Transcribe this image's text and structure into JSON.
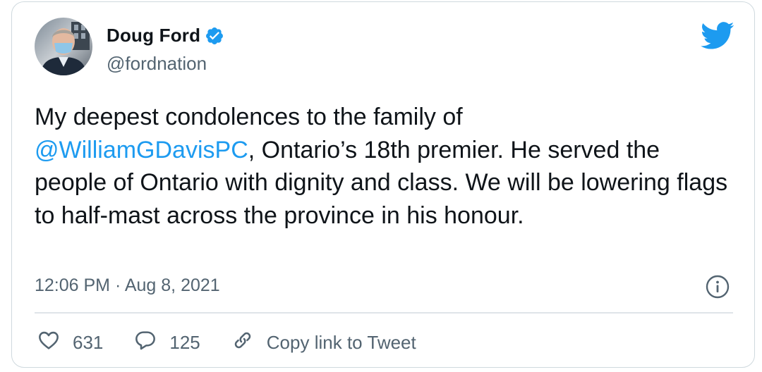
{
  "author": {
    "display_name": "Doug Ford",
    "handle": "@fordnation",
    "verified": true
  },
  "tweet": {
    "line1": "My deepest condolences to the family of",
    "mention": "@WilliamGDavisPC",
    "rest": ", Ontario’s 18th premier. He served the people of Ontario with dignity and class. We will be lowering flags to half-mast across the province in his honour.",
    "timestamp": "12:06 PM · Aug 8, 2021"
  },
  "actions": {
    "likes": "631",
    "replies": "125",
    "copy_link_label": "Copy link to Tweet"
  },
  "colors": {
    "accent": "#1d9bf0",
    "text": "#0f1419",
    "muted": "#536471",
    "border": "#cfd9de"
  },
  "icons": {
    "verified": "verified-badge-icon",
    "brand": "twitter-bird-icon",
    "info": "info-icon",
    "like": "heart-icon",
    "reply": "speech-bubble-icon",
    "link": "link-icon"
  }
}
